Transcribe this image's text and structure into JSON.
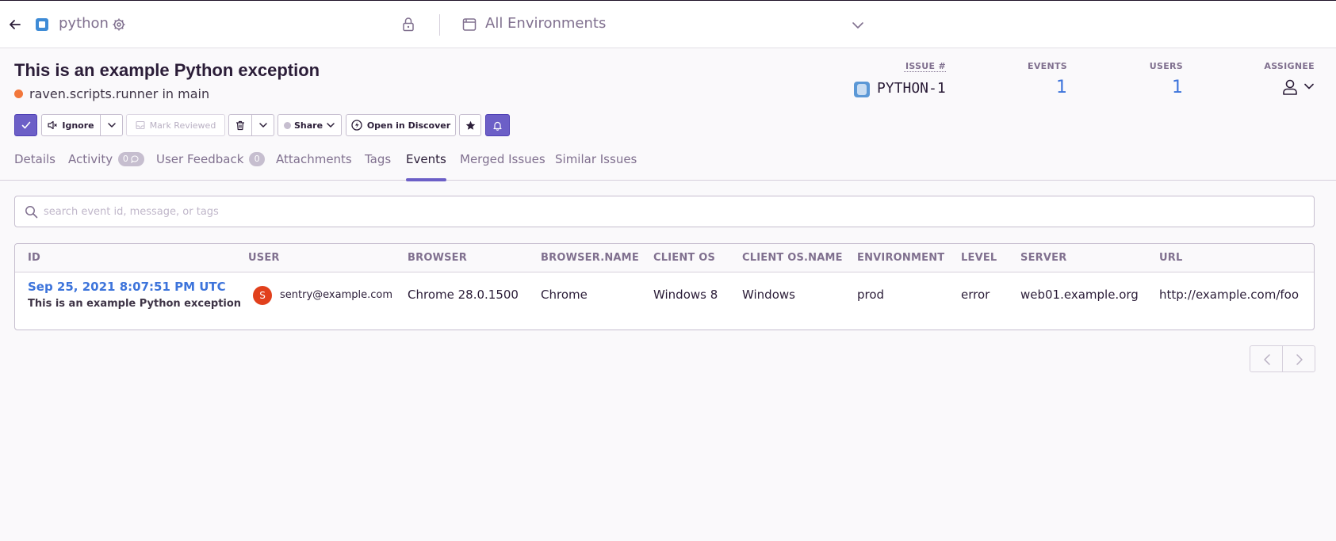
{
  "topbar": {
    "project_name": "python",
    "environment_label": "All Environments"
  },
  "issue": {
    "title": "This is an example Python exception",
    "culprit": "raven.scripts.runner in main",
    "stats": {
      "issue_label": "ISSUE #",
      "issue_id": "PYTHON-1",
      "events_label": "EVENTS",
      "events_value": "1",
      "users_label": "USERS",
      "users_value": "1",
      "assignee_label": "ASSIGNEE"
    }
  },
  "actions": {
    "ignore_label": "Ignore",
    "mark_reviewed_label": "Mark Reviewed",
    "share_label": "Share",
    "discover_label": "Open in Discover"
  },
  "tabs": [
    {
      "label": "Details"
    },
    {
      "label": "Activity",
      "badge": "0"
    },
    {
      "label": "User Feedback",
      "badge": "0"
    },
    {
      "label": "Attachments"
    },
    {
      "label": "Tags"
    },
    {
      "label": "Events",
      "active": true
    },
    {
      "label": "Merged Issues"
    },
    {
      "label": "Similar Issues"
    }
  ],
  "search": {
    "placeholder": "search event id, message, or tags",
    "value": ""
  },
  "table": {
    "columns": [
      "ID",
      "USER",
      "BROWSER",
      "BROWSER.NAME",
      "CLIENT OS",
      "CLIENT OS.NAME",
      "ENVIRONMENT",
      "LEVEL",
      "SERVER",
      "URL"
    ],
    "rows": [
      {
        "date": "Sep 25, 2021 8:07:51 PM UTC",
        "message": "This is an example Python exception",
        "user_initial": "S",
        "user": "sentry@example.com",
        "browser": "Chrome 28.0.1500",
        "browser_name": "Chrome",
        "client_os": "Windows 8",
        "client_os_name": "Windows",
        "environment": "prod",
        "level": "error",
        "server": "web01.example.org",
        "url": "http://example.com/foo"
      }
    ]
  },
  "colors": {
    "accent": "#6c5fc7",
    "link": "#3d74db",
    "culprit_dot": "#f2773b",
    "avatar": "#e1401c"
  }
}
